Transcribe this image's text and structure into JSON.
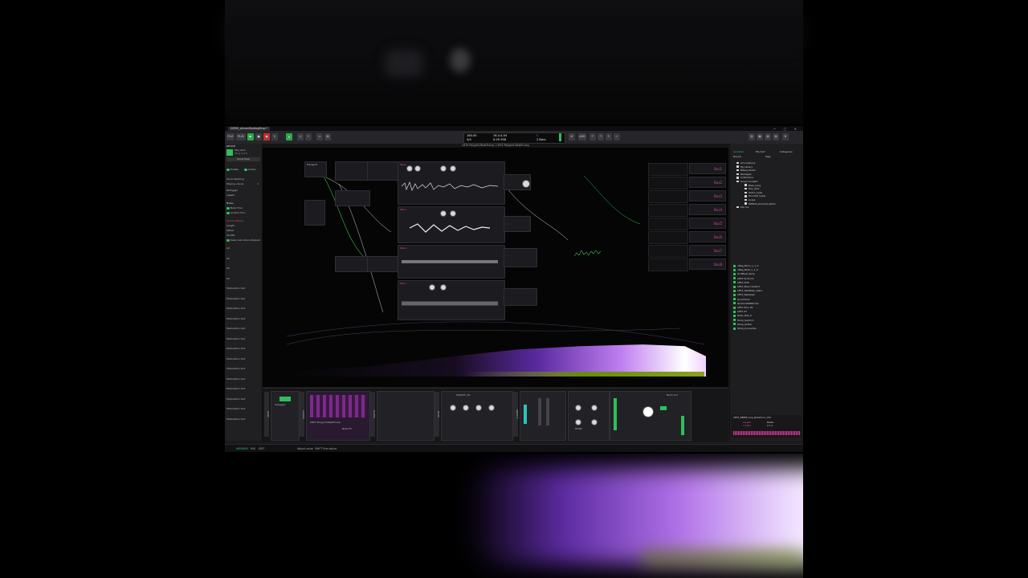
{
  "app": {
    "tab_title": "DEMO_ohnaoStudiogDrop *",
    "project_title": "LBTX Polygrid BeatTrump / LBTX Polygrid BeatTrump"
  },
  "toolbar": {
    "file": "FILE",
    "play_label": "PLAY",
    "tempo": "160.00",
    "position": "16.4.4.04",
    "signature": "4/4",
    "time": "0:29 958",
    "metronome": "C",
    "key": "2 Bars",
    "add": "ADD"
  },
  "inspector": {
    "section": "DEVICE",
    "device_name": "Poly Grid",
    "device_sub": "(Poly Grid)",
    "show_help": "Show Help",
    "enable": "Enable",
    "active": "Active",
    "voice_stacking": "Voice Stacking",
    "playing_voices": "Playing voices",
    "voice_count": "1",
    "retrigger": "Retrigger",
    "legato": "Legato",
    "notes": "Notes",
    "note_thru": "Note Thru",
    "control_thru": "Control Thru",
    "groove": "Groove Player",
    "length": "Length",
    "offset": "Offset",
    "shuffle": "Shuffle",
    "keep": "Keep new when stopped",
    "mod_items": [
      "All",
      "All",
      "All",
      "All",
      "Modulation Out",
      "Modulation Out",
      "Modulation Out",
      "Modulation Out",
      "Modulation Out",
      "Modulation Out",
      "Modulation Out",
      "Modulation Out",
      "Modulation Out",
      "Modulation Out",
      "Modulation Out",
      "Modulation Out",
      "Modulation Out",
      "Modulation Out"
    ]
  },
  "canvas": {
    "buses": [
      "Bus1",
      "Bus2",
      "Bus3",
      "Bus4",
      "Bus5",
      "Bus6",
      "Bus7",
      "Bus8"
    ],
    "module_labels": [
      "Transport",
      "Wave",
      "Wave",
      "Wave",
      "Wave"
    ]
  },
  "browser": {
    "tabs": [
      "Locations",
      "File Sort",
      "Categories"
    ],
    "filter_device": "Device",
    "filter_tags": "Tags",
    "locations": [
      "All Locations",
      "My Library",
      "Bitwig Studio",
      "Packages",
      "Collections",
      "Sound Content",
      "Bass_Long",
      "Poly_Stut",
      "Glitch_Cybe",
      "Drumkit_Cyber",
      "Loops",
      "DEMOS_Drumkit_Glitch",
      "Pop ins"
    ],
    "files": [
      "nBeg_Mono_v_1_0",
      "nBeg_Multi_v_1_0",
      "GridBeat_Temp",
      "LBTX DJ Zoom",
      "LBTX Drift",
      "LBTX_BounceGlitch",
      "LBTX_GRUNGR_alpha",
      "LBTX_Repeater",
      "QuickSlicer",
      "RandomBitPatcher",
      "LBTX Zero Pb",
      "LBTX ST",
      "Ratio_Dist_X",
      "Temp_Gadmm",
      "Temp_Glitter",
      "Temp_bounsribe"
    ],
    "preview_file": "LBTX_BBEM_loop_Notefrom_130",
    "preview_length": "Length",
    "preview_length_val": "2.436s",
    "preview_beats": "Beats",
    "preview_beats_val": "2.1.1"
  },
  "devices": {
    "labels": [
      "Arpeggio",
      "LBTX Polygrid BeatTrump",
      "Note FX",
      "LEGOTT_V2",
      "Shaper",
      "Stereo",
      "Width",
      "Ratio",
      "Mix",
      "Pre Gain",
      "Crush",
      "Nomi 4.0"
    ],
    "chain_names": [
      "NAME",
      "LOUDER",
      "PLAYER",
      "NOISE",
      "PRESETS"
    ]
  },
  "status": {
    "arrange": "ARRANGE",
    "mix": "MIX",
    "edit": "EDIT",
    "hint1": "Adjust value",
    "hint2": "SHIFT",
    "hint3": "Fine adjust"
  }
}
